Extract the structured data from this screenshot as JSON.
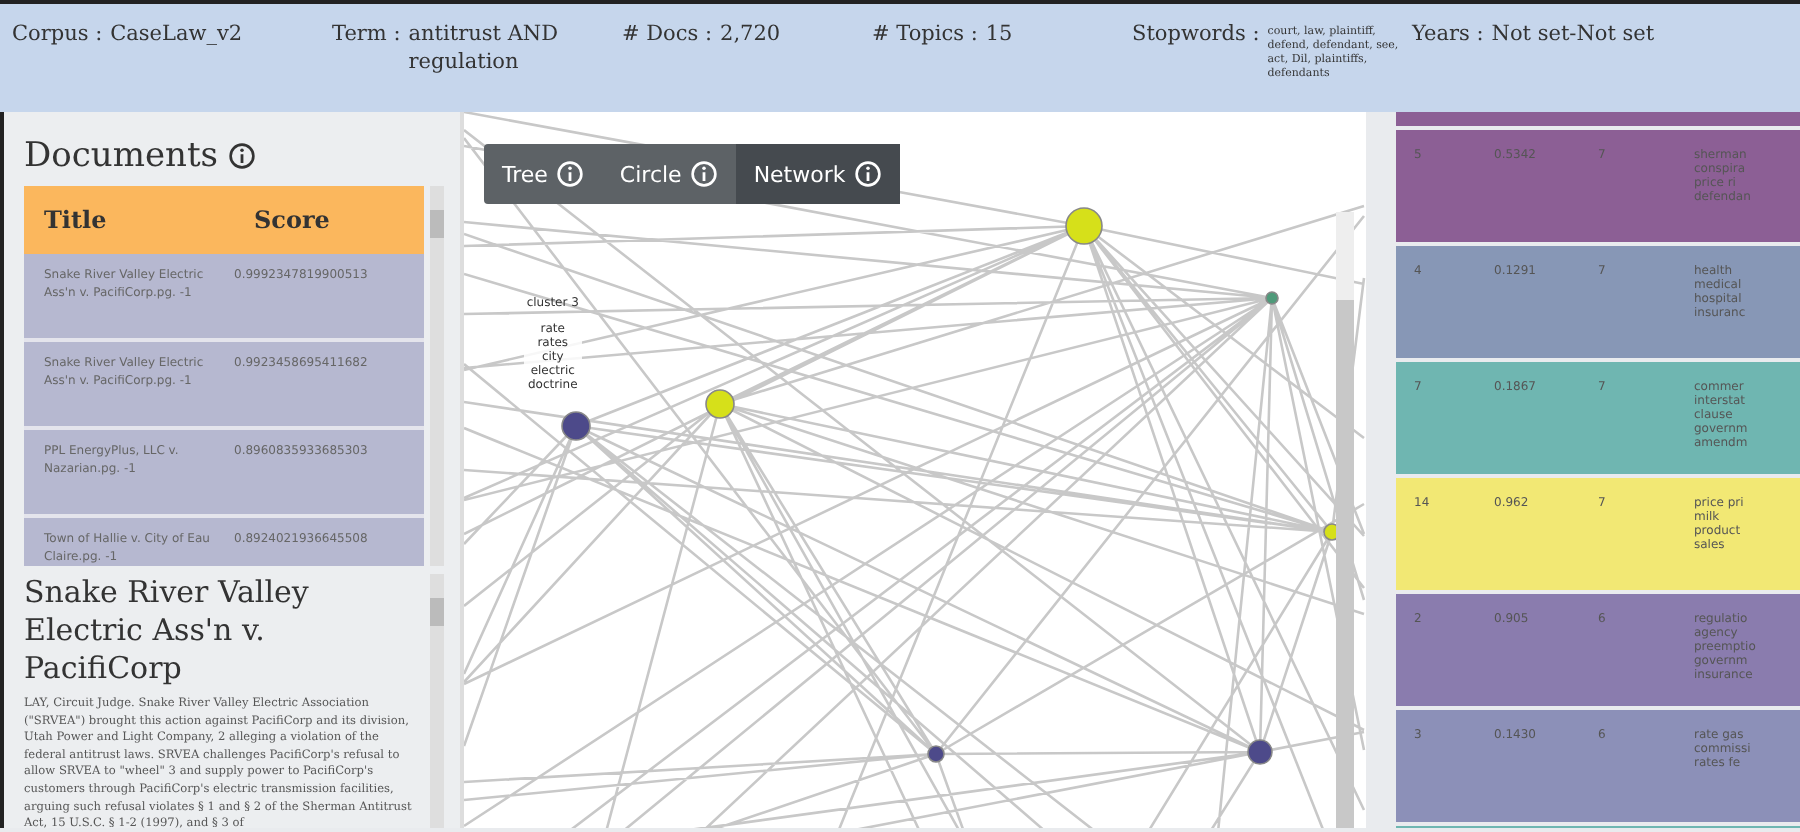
{
  "header": [
    {
      "label": "Corpus :",
      "value": "CaseLaw_v2"
    },
    {
      "label": "Term :",
      "value": "antitrust AND regulation"
    },
    {
      "label": "# Docs :",
      "value": "2,720"
    },
    {
      "label": "# Topics :",
      "value": "15"
    },
    {
      "label": "Stopwords :",
      "value": "court, law, plaintiff, defend, defendant, see, act, Dil, plaintiffs, defendants",
      "small": true
    },
    {
      "label": "Years :",
      "value": "Not set-Not set"
    }
  ],
  "documents": {
    "title": "Documents",
    "columns": [
      "Title",
      "Score"
    ],
    "rows": [
      {
        "title": "Snake River Valley Electric Ass'n v. PacifiCorp.pg. -1",
        "score": "0.9992347819900513"
      },
      {
        "title": "Snake River Valley Electric Ass'n v. PacifiCorp.pg. -1",
        "score": "0.9923458695411682"
      },
      {
        "title": "PPL EnergyPlus, LLC v. Nazarian.pg. -1",
        "score": "0.8960835933685303"
      },
      {
        "title": "Town of Hallie v. City of Eau Claire.pg. -1",
        "score": "0.8924021936645508"
      }
    ]
  },
  "detail": {
    "title": "Snake River Valley Electric Ass'n v. PacifiCorp",
    "text": "LAY, Circuit Judge. Snake River Valley Electric Association (\"SRVEA\") brought this action against PacifiCorp and its division, Utah Power and Light Company, 2 alleging a violation of the federal antitrust laws. SRVEA challenges PacifiCorp's refusal to allow SRVEA to \"wheel\" 3 and supply power to PacifiCorp's customers through PacifiCorp's electric transmission facilities, arguing such refusal violates § 1 and § 2 of the Sherman Antitrust Act, 15 U.S.C. § 1-2 (1997), and § 3 of"
  },
  "view_tabs": [
    {
      "label": "Tree",
      "selected": false
    },
    {
      "label": "Circle",
      "selected": false
    },
    {
      "label": "Network",
      "selected": true
    }
  ],
  "network": {
    "cluster_label": "cluster 3",
    "cluster_words": [
      "rate",
      "rates",
      "city",
      "electric",
      "doctrine"
    ]
  },
  "topics": [
    {
      "topic": "5",
      "score": "0.5342",
      "count": "7",
      "words": [
        "sherman",
        "conspira",
        "price ri",
        "defendan"
      ],
      "color": "#8c5f95"
    },
    {
      "topic": "4",
      "score": "0.1291",
      "count": "7",
      "words": [
        "health",
        "medical",
        "hospital",
        "insuranc"
      ],
      "color": "#8797b6"
    },
    {
      "topic": "7",
      "score": "0.1867",
      "count": "7",
      "words": [
        "commer",
        "interstat",
        "clause",
        "governm",
        "amendm"
      ],
      "color": "#6fb6b1"
    },
    {
      "topic": "14",
      "score": "0.962",
      "count": "7",
      "words": [
        "price pri",
        "milk",
        "product",
        "sales"
      ],
      "color": "#f2e874"
    },
    {
      "topic": "2",
      "score": "0.905",
      "count": "6",
      "words": [
        "regulatio",
        "agency",
        "preemptio",
        "governm",
        "insurance"
      ],
      "color": "#8a7cae"
    },
    {
      "topic": "3",
      "score": "0.1430",
      "count": "6",
      "words": [
        "rate gas",
        "commissi",
        "rates fe"
      ],
      "color": "#8c90b8"
    }
  ]
}
